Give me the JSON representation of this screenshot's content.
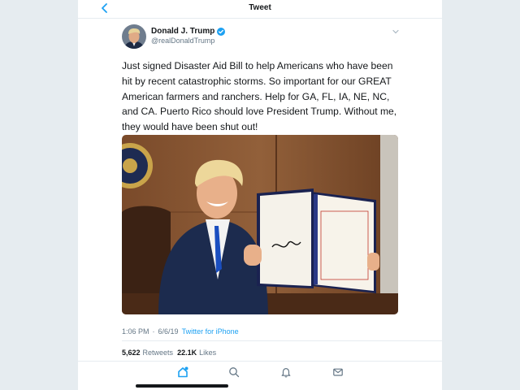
{
  "header": {
    "title": "Tweet",
    "back_icon": "chevron-left-icon"
  },
  "author": {
    "display_name": "Donald J. Trump",
    "handle": "@realDonaldTrump",
    "verified": true,
    "verified_icon": "verified-badge-icon"
  },
  "tweet": {
    "text": "Just signed Disaster Aid Bill to help Americans who have been hit by recent catastrophic storms. So important for our GREAT American farmers and ranchers. Help for GA, FL, IA, NE, NC, and CA. Puerto Rico should love President Trump. Without me, they would have been shut out!",
    "media_icon": "photo-signing-bill",
    "time": "1:06 PM",
    "separator": "·",
    "date": "6/6/19",
    "source": "Twitter for iPhone"
  },
  "stats": {
    "retweets_count": "5,622",
    "retweets_label": "Retweets",
    "likes_count": "22.1K",
    "likes_label": "Likes"
  },
  "tabbar": {
    "items": [
      {
        "icon": "home-icon",
        "active": true
      },
      {
        "icon": "search-icon",
        "active": false
      },
      {
        "icon": "bell-icon",
        "active": false
      },
      {
        "icon": "mail-icon",
        "active": false
      }
    ]
  },
  "colors": {
    "accent": "#1da1f2",
    "text_primary": "#14171a",
    "text_secondary": "#657786",
    "sidebar_bg": "#e6ecf0"
  }
}
